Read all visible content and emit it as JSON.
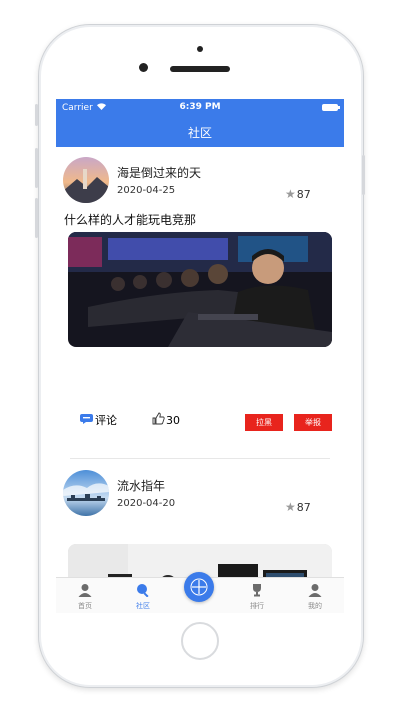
{
  "status_bar": {
    "carrier": "Carrier",
    "time": "6:39 PM"
  },
  "nav": {
    "title": "社区"
  },
  "posts": [
    {
      "username": "海是倒过来的天",
      "date": "2020-04-25",
      "stars": "87",
      "text": "什么样的人才能玩电竞那",
      "comment_label": "评论",
      "likes": "30",
      "block_label": "拉黑",
      "report_label": "举报"
    },
    {
      "username": "流水指年",
      "date": "2020-04-20",
      "stars": "87"
    }
  ],
  "tabs": [
    {
      "label": "首页",
      "icon": "person-icon"
    },
    {
      "label": "社区",
      "icon": "search-icon",
      "active": true
    },
    {
      "label": "",
      "icon": "compass-plus-icon"
    },
    {
      "label": "排行",
      "icon": "trophy-icon"
    },
    {
      "label": "我的",
      "icon": "person-icon"
    }
  ],
  "colors": {
    "accent": "#3b7bea",
    "danger": "#e8241d"
  }
}
